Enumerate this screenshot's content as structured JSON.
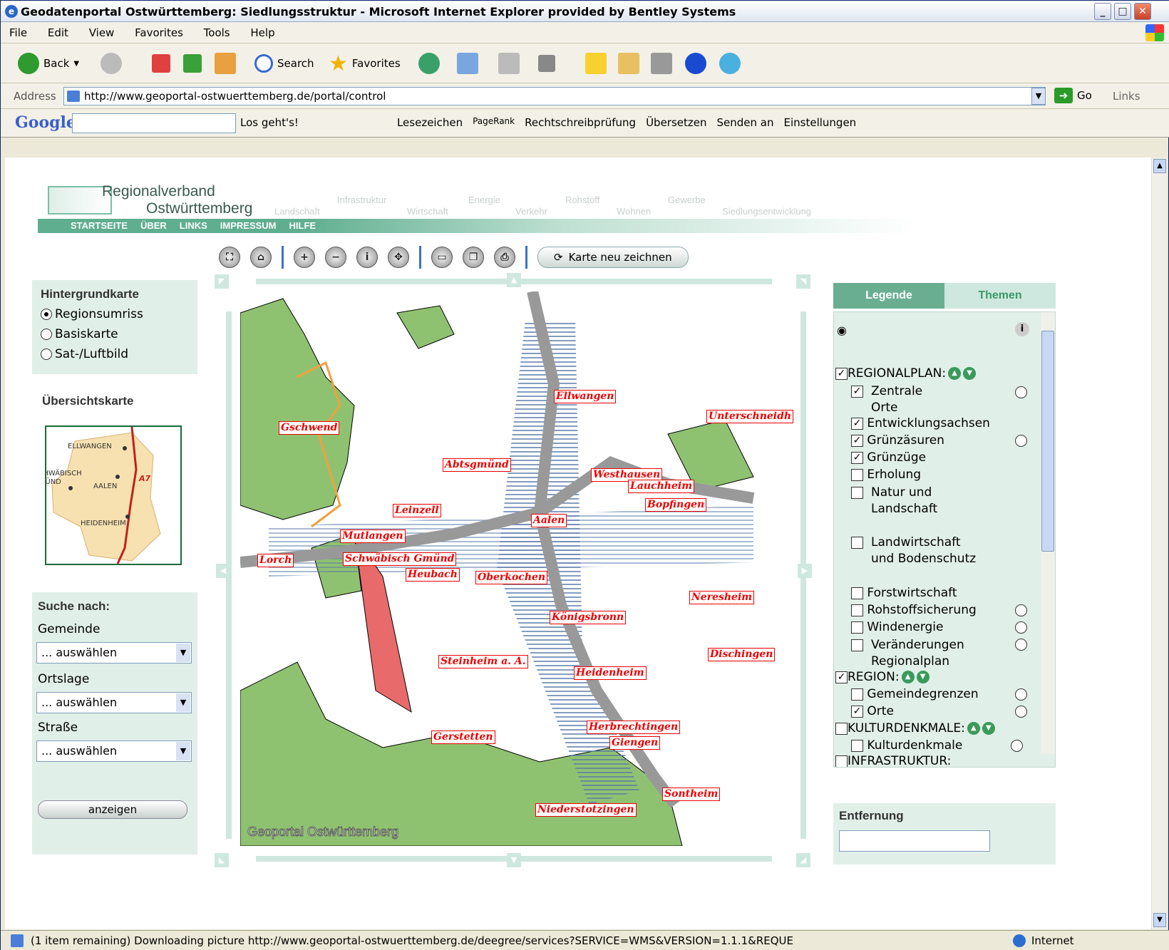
{
  "window": {
    "title": "Geodatenportal Ostwürttemberg: Siedlungsstruktur - Microsoft Internet Explorer provided by Bentley Systems"
  },
  "menu": [
    "File",
    "Edit",
    "View",
    "Favorites",
    "Tools",
    "Help"
  ],
  "toolbar": {
    "back": "Back",
    "search": "Search",
    "favorites": "Favorites"
  },
  "address": {
    "label": "Address",
    "url": "http://www.geoportal-ostwuerttemberg.de/portal/control",
    "go": "Go",
    "links": "Links"
  },
  "google": {
    "logo": "Google",
    "items": [
      "Los geht's!",
      "Lesezeichen",
      "PageRank",
      "Rechtschreibprüfung",
      "Übersetzen",
      "Senden an",
      "Einstellungen"
    ]
  },
  "site": {
    "name1": "Regionalverband",
    "name2": "Ostwürttemberg",
    "themes": [
      "Landschaft",
      "Infrastruktur",
      "Wirtschaft",
      "Energie",
      "Verkehr",
      "Rohstoff",
      "Wohnen",
      "Gewerbe",
      "Siedlungsentwicklung"
    ],
    "nav": [
      "STARTSEITE",
      "ÜBER",
      "LINKS",
      "IMPRESSUM",
      "HILFE"
    ]
  },
  "maptools": {
    "redraw": "Karte neu zeichnen"
  },
  "background": {
    "title": "Hintergrundkarte",
    "options": [
      "Regionsumriss",
      "Basiskarte",
      "Sat-/Luftbild"
    ],
    "selected": 0
  },
  "overview": {
    "title": "Übersichtskarte",
    "labels": [
      "ELLWANGEN",
      "SCHWÄBISCH GMÜND",
      "AALEN",
      "A7",
      "HEIDENHEIM"
    ]
  },
  "search": {
    "title": "Suche nach:",
    "fields": [
      {
        "label": "Gemeinde",
        "value": "... auswählen"
      },
      {
        "label": "Ortslage",
        "value": "... auswählen"
      },
      {
        "label": "Straße",
        "value": "... auswählen"
      }
    ],
    "button": "anzeigen"
  },
  "map": {
    "watermark": "Geoportal Ostwürttemberg",
    "towns": [
      "Ellwangen",
      "Unterschneidh",
      "Gschwend",
      "Abtsgmünd",
      "Westhausen",
      "Lauchheim",
      "Bopfingen",
      "Leinzell",
      "Aalen",
      "Mutlangen",
      "Lorch",
      "Schwäbisch Gmünd",
      "Heubach",
      "Oberkochen",
      "Neresheim",
      "Königsbronn",
      "Dischingen",
      "Steinheim a. A.",
      "Heidenheim",
      "Herbrechtingen",
      "Gerstetten",
      "Giengen",
      "Sontheim",
      "Niederstotzingen"
    ]
  },
  "legend": {
    "tabs": [
      "Legende",
      "Themen"
    ],
    "items": [
      {
        "label": "REGIONALPLAN:",
        "checked": true,
        "level": 0
      },
      {
        "label": "Zentrale Orte",
        "checked": true,
        "level": 1
      },
      {
        "label": "Entwicklungsachsen",
        "checked": true,
        "level": 1
      },
      {
        "label": "Grünzäsuren",
        "checked": true,
        "level": 1
      },
      {
        "label": "Grünzüge",
        "checked": true,
        "level": 1
      },
      {
        "label": "Erholung",
        "checked": false,
        "level": 1
      },
      {
        "label": "Natur und Landschaft",
        "checked": false,
        "level": 1
      },
      {
        "label": "Landwirtschaft und Bodenschutz",
        "checked": false,
        "level": 1
      },
      {
        "label": "Forstwirtschaft",
        "checked": false,
        "level": 1
      },
      {
        "label": "Rohstoffsicherung",
        "checked": false,
        "level": 1
      },
      {
        "label": "Windenergie",
        "checked": false,
        "level": 1
      },
      {
        "label": "Veränderungen Regionalplan",
        "checked": false,
        "level": 1
      },
      {
        "label": "REGION:",
        "checked": true,
        "level": 0
      },
      {
        "label": "Gemeindegrenzen",
        "checked": false,
        "level": 1
      },
      {
        "label": "Orte",
        "checked": true,
        "level": 1
      },
      {
        "label": "KULTURDENKMALE:",
        "checked": false,
        "level": 0
      },
      {
        "label": "Kulturdenkmale",
        "checked": false,
        "level": 1
      },
      {
        "label": "INFRASTRUKTUR:",
        "checked": false,
        "level": 0
      }
    ]
  },
  "distance": {
    "title": "Entfernung",
    "value": ""
  },
  "status": {
    "message": "(1 item remaining) Downloading picture http://www.geoportal-ostwuerttemberg.de/deegree/services?SERVICE=WMS&VERSION=1.1.1&REQUE",
    "zone": "Internet"
  }
}
